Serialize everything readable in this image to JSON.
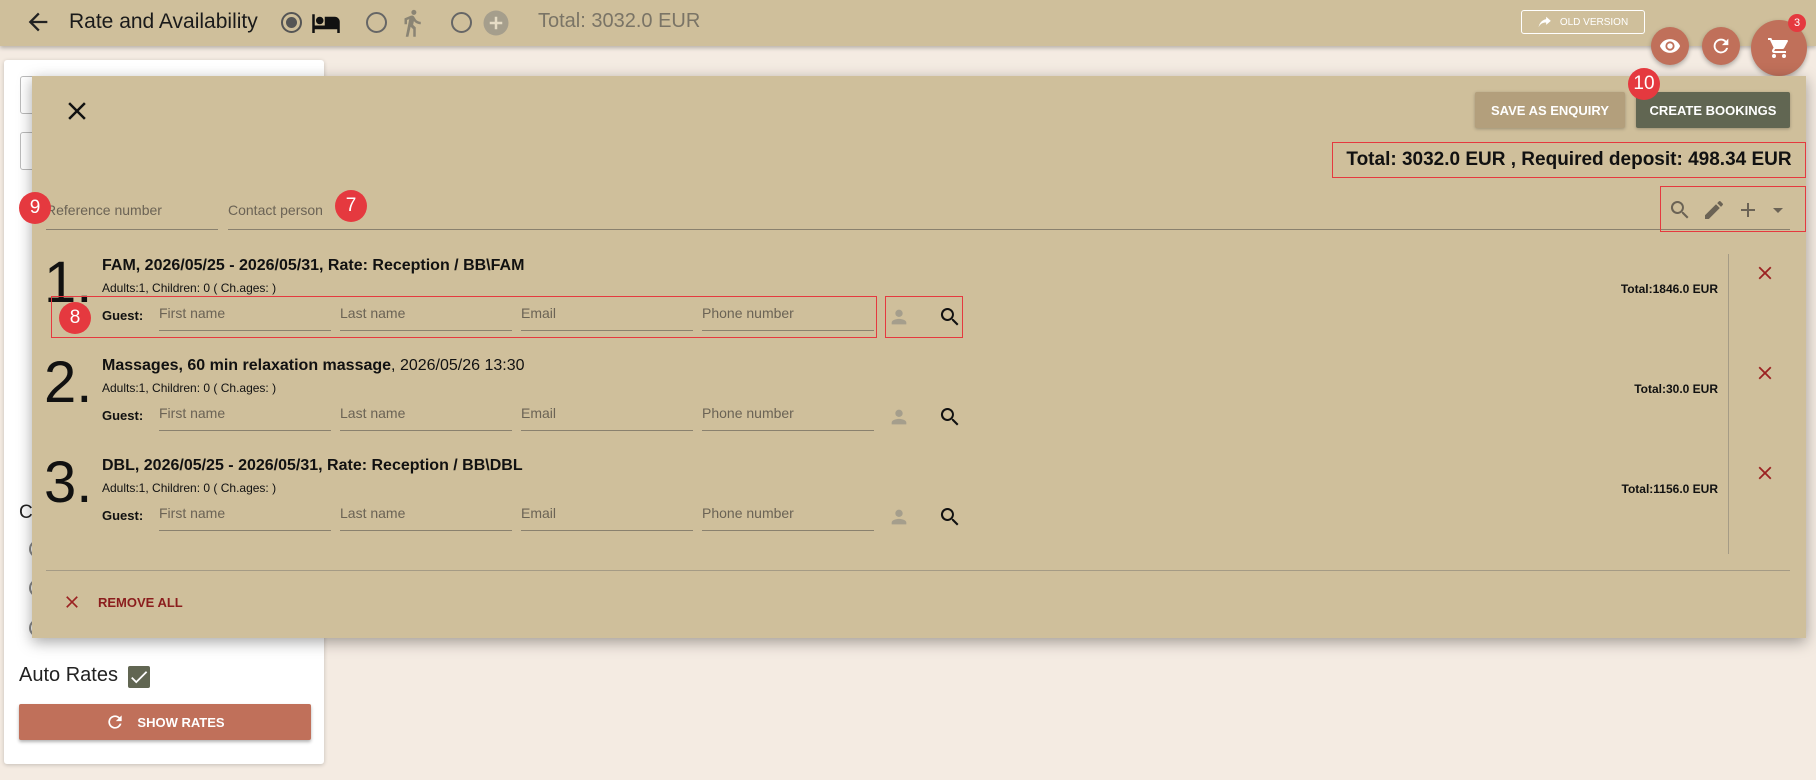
{
  "header": {
    "title": "Rate and Availability",
    "total": "Total: 3032.0 EUR",
    "old_version": "OLD VERSION",
    "cart_count": "3"
  },
  "left_panel": {
    "section_letter": "C",
    "auto_rates_label": "Auto Rates",
    "auto_rates_checked": true,
    "show_rates_label": "SHOW RATES"
  },
  "dialog": {
    "save_enquiry_label": "SAVE AS ENQUIRY",
    "create_bookings_label": "CREATE BOOKINGS",
    "total_deposit": "Total: 3032.0 EUR , Required deposit: 498.34 EUR",
    "reference_placeholder": "Reference number",
    "contact_placeholder": "Contact person",
    "remove_all_label": "REMOVE ALL",
    "lines": [
      {
        "num": "1.",
        "title_bold": "FAM, 2026/05/25 - 2026/05/31, Rate: Reception / BB\\FAM",
        "title_normal": "",
        "sub": "Adults:1, Children: 0 ( Ch.ages: )",
        "total": "Total:1846.0 EUR"
      },
      {
        "num": "2.",
        "title_bold": "Massages, 60 min relaxation massage",
        "title_normal": ", 2026/05/26 13:30",
        "sub": "Adults:1, Children: 0 ( Ch.ages: )",
        "total": "Total:30.0 EUR"
      },
      {
        "num": "3.",
        "title_bold": "DBL, 2026/05/25 - 2026/05/31, Rate: Reception / BB\\DBL",
        "title_normal": "",
        "sub": "Adults:1, Children: 0 ( Ch.ages: )",
        "total": "Total:1156.0 EUR"
      }
    ],
    "guest": {
      "label": "Guest:",
      "first_name": "First name",
      "last_name": "Last name",
      "email": "Email",
      "phone": "Phone number"
    }
  },
  "markers": {
    "m7": "7",
    "m8": "8",
    "m9": "9",
    "m10": "10"
  },
  "colors": {
    "header_bg": "#cfbf9b",
    "primary_dark": "#616652",
    "accent": "#c0705a",
    "danger": "#8b1d1d",
    "marker": "#e5393f"
  }
}
